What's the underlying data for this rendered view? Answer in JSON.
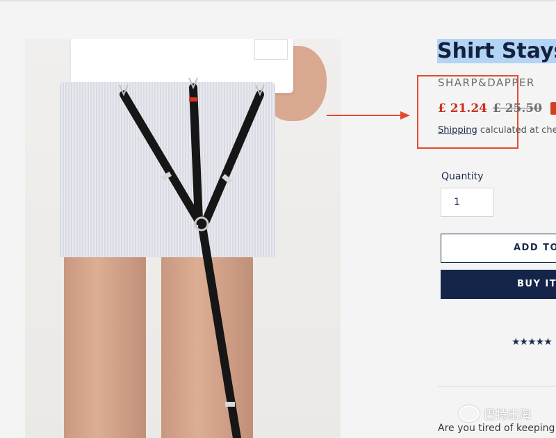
{
  "product": {
    "title": "Shirt Stays",
    "title_suffix": " -",
    "vendor": "SHARP&DAPPER",
    "sale_price": "£ 21.24",
    "compare_price": "£ 25.50",
    "shipping_link": "Shipping",
    "shipping_note": " calculated at checkout",
    "quantity_label": "Quantity",
    "quantity_value": "1",
    "add_to_cart_label": "ADD TO",
    "buy_now_label": "BUY IT",
    "rating_stars": "★★★★★",
    "description_preview": "Are you tired of keeping pu"
  },
  "watermark": {
    "text": "巴特出海"
  },
  "colors": {
    "accent_sale": "#c9301e",
    "brand_navy": "#152449",
    "annotation_red": "#e24a2d",
    "title_highlight": "#b3d4f5"
  }
}
